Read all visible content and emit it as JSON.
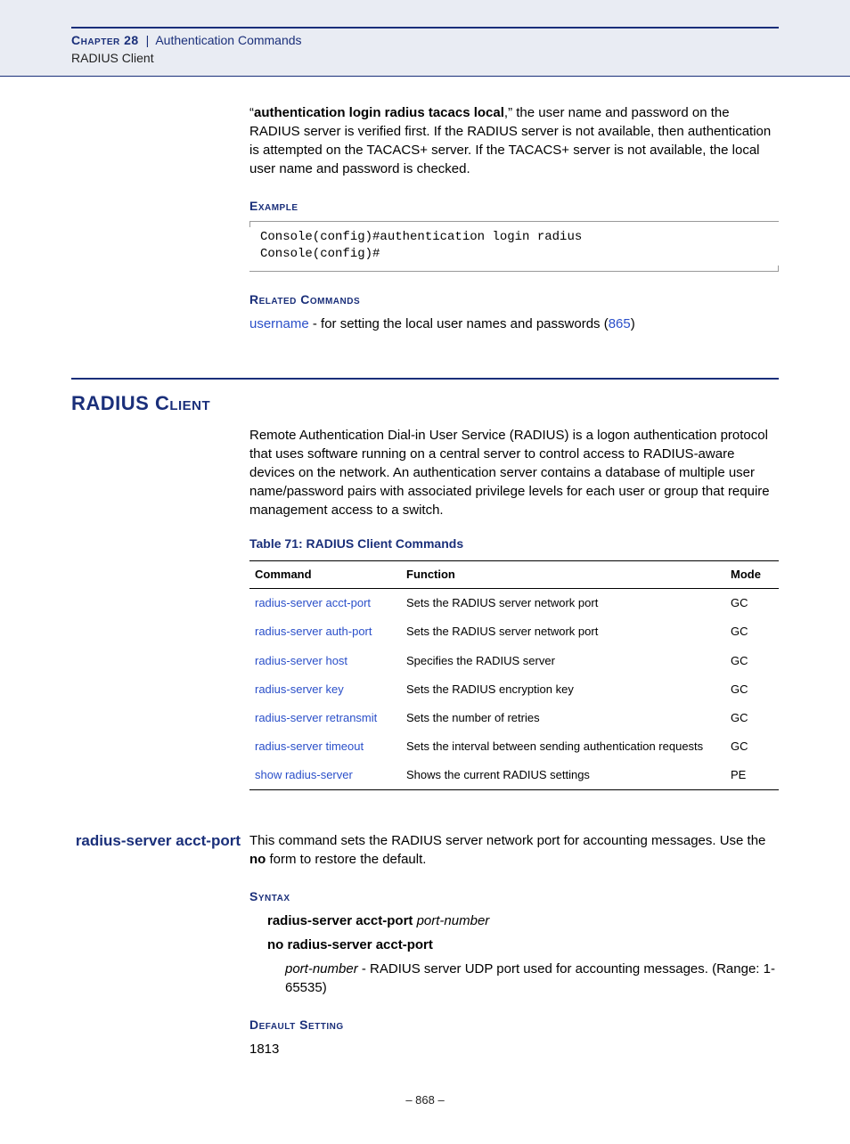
{
  "header": {
    "chapter": "Chapter 28",
    "separator": "|",
    "title": "Authentication Commands",
    "subtitle": "RADIUS Client"
  },
  "intro": {
    "quote_open": "“",
    "bold_cmd": "authentication login radius tacacs local",
    "rest": ",” the user name and password on the RADIUS server is verified first. If the RADIUS server is not available, then authentication is attempted on the TACACS+ server. If the TACACS+ server is not available, the local user name and password is checked."
  },
  "example": {
    "label": "Example",
    "code": "Console(config)#authentication login radius\nConsole(config)#"
  },
  "related": {
    "label": "Related Commands",
    "link": "username",
    "text": " - for setting the local user names and passwords (",
    "pageref": "865",
    "close": ")"
  },
  "section": {
    "title": "RADIUS Client",
    "para": "Remote Authentication Dial-in User Service (RADIUS) is a logon authentication protocol that uses software running on a central server to control access to RADIUS-aware devices on the network. An authentication server contains a database of multiple user name/password pairs with associated privilege levels for each user or group that require management access to a switch."
  },
  "table": {
    "caption": "Table 71: RADIUS Client Commands",
    "headers": {
      "command": "Command",
      "function": "Function",
      "mode": "Mode"
    },
    "rows": [
      {
        "command": "radius-server acct-port",
        "function": "Sets the RADIUS server network port",
        "mode": "GC"
      },
      {
        "command": "radius-server auth-port",
        "function": "Sets the RADIUS server network port",
        "mode": "GC"
      },
      {
        "command": "radius-server host",
        "function": "Specifies the RADIUS server",
        "mode": "GC"
      },
      {
        "command": "radius-server key",
        "function": "Sets the RADIUS encryption key",
        "mode": "GC"
      },
      {
        "command": "radius-server retransmit",
        "function": "Sets the number of retries",
        "mode": "GC"
      },
      {
        "command": "radius-server timeout",
        "function": "Sets the interval between sending authentication requests",
        "mode": "GC"
      },
      {
        "command": "show radius-server",
        "function": "Shows the current RADIUS settings",
        "mode": "PE"
      }
    ]
  },
  "cmd": {
    "name": "radius-server acct-port",
    "desc_pre": "This command sets the RADIUS server network port for accounting messages. Use the ",
    "desc_bold": "no",
    "desc_post": " form to restore the default.",
    "syntax_label": "Syntax",
    "syntax_line1_bold": "radius-server acct-port ",
    "syntax_line1_ital": "port-number",
    "syntax_line2": "no radius-server acct-port",
    "param_ital": "port-number",
    "param_desc": " - RADIUS server UDP port used for accounting messages. (Range: 1-65535)",
    "default_label": "Default Setting",
    "default_value": "1813"
  },
  "footer": {
    "page": "–  868  –"
  },
  "chart_data": {
    "type": "table",
    "title": "Table 71: RADIUS Client Commands",
    "columns": [
      "Command",
      "Function",
      "Mode"
    ],
    "rows": [
      [
        "radius-server acct-port",
        "Sets the RADIUS server network port",
        "GC"
      ],
      [
        "radius-server auth-port",
        "Sets the RADIUS server network port",
        "GC"
      ],
      [
        "radius-server host",
        "Specifies the RADIUS server",
        "GC"
      ],
      [
        "radius-server key",
        "Sets the RADIUS encryption key",
        "GC"
      ],
      [
        "radius-server retransmit",
        "Sets the number of retries",
        "GC"
      ],
      [
        "radius-server timeout",
        "Sets the interval between sending authentication requests",
        "GC"
      ],
      [
        "show radius-server",
        "Shows the current RADIUS settings",
        "PE"
      ]
    ]
  }
}
